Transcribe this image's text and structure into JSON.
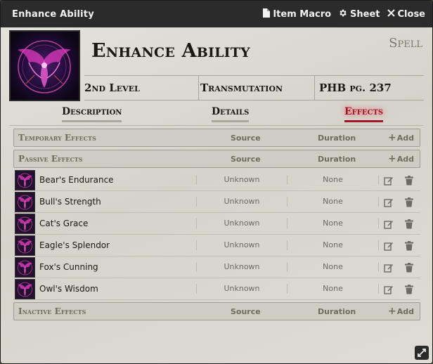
{
  "window": {
    "title": "Enhance Ability",
    "buttons": [
      {
        "label": "Item Macro",
        "icon": "document-icon"
      },
      {
        "label": "Sheet",
        "icon": "gear-icon"
      },
      {
        "label": "Close",
        "icon": "close-icon"
      }
    ]
  },
  "item": {
    "name": "Enhance Ability",
    "type": "Spell",
    "level": "2nd Level",
    "school": "Transmutation",
    "source": "PHB pg. 237"
  },
  "tabs": [
    {
      "label": "Description",
      "active": false
    },
    {
      "label": "Details",
      "active": false
    },
    {
      "label": "Effects",
      "active": true
    }
  ],
  "sections": {
    "temporary": {
      "label": "Temporary Effects",
      "source": "Source",
      "duration": "Duration",
      "add": "Add"
    },
    "passive": {
      "label": "Passive Effects",
      "source": "Source",
      "duration": "Duration",
      "add": "Add"
    },
    "inactive": {
      "label": "Inactive Effects",
      "source": "Source",
      "duration": "Duration",
      "add": "Add"
    }
  },
  "effects": [
    {
      "name": "Bear's Endurance",
      "source": "Unknown",
      "duration": "None"
    },
    {
      "name": "Bull's Strength",
      "source": "Unknown",
      "duration": "None"
    },
    {
      "name": "Cat's Grace",
      "source": "Unknown",
      "duration": "None"
    },
    {
      "name": "Eagle's Splendor",
      "source": "Unknown",
      "duration": "None"
    },
    {
      "name": "Fox's Cunning",
      "source": "Unknown",
      "duration": "None"
    },
    {
      "name": "Owl's Wisdom",
      "source": "Unknown",
      "duration": "None"
    }
  ],
  "colors": {
    "accent": "#a01622",
    "titlebar": "#2b2b2b",
    "panel": "#dcdad3"
  }
}
